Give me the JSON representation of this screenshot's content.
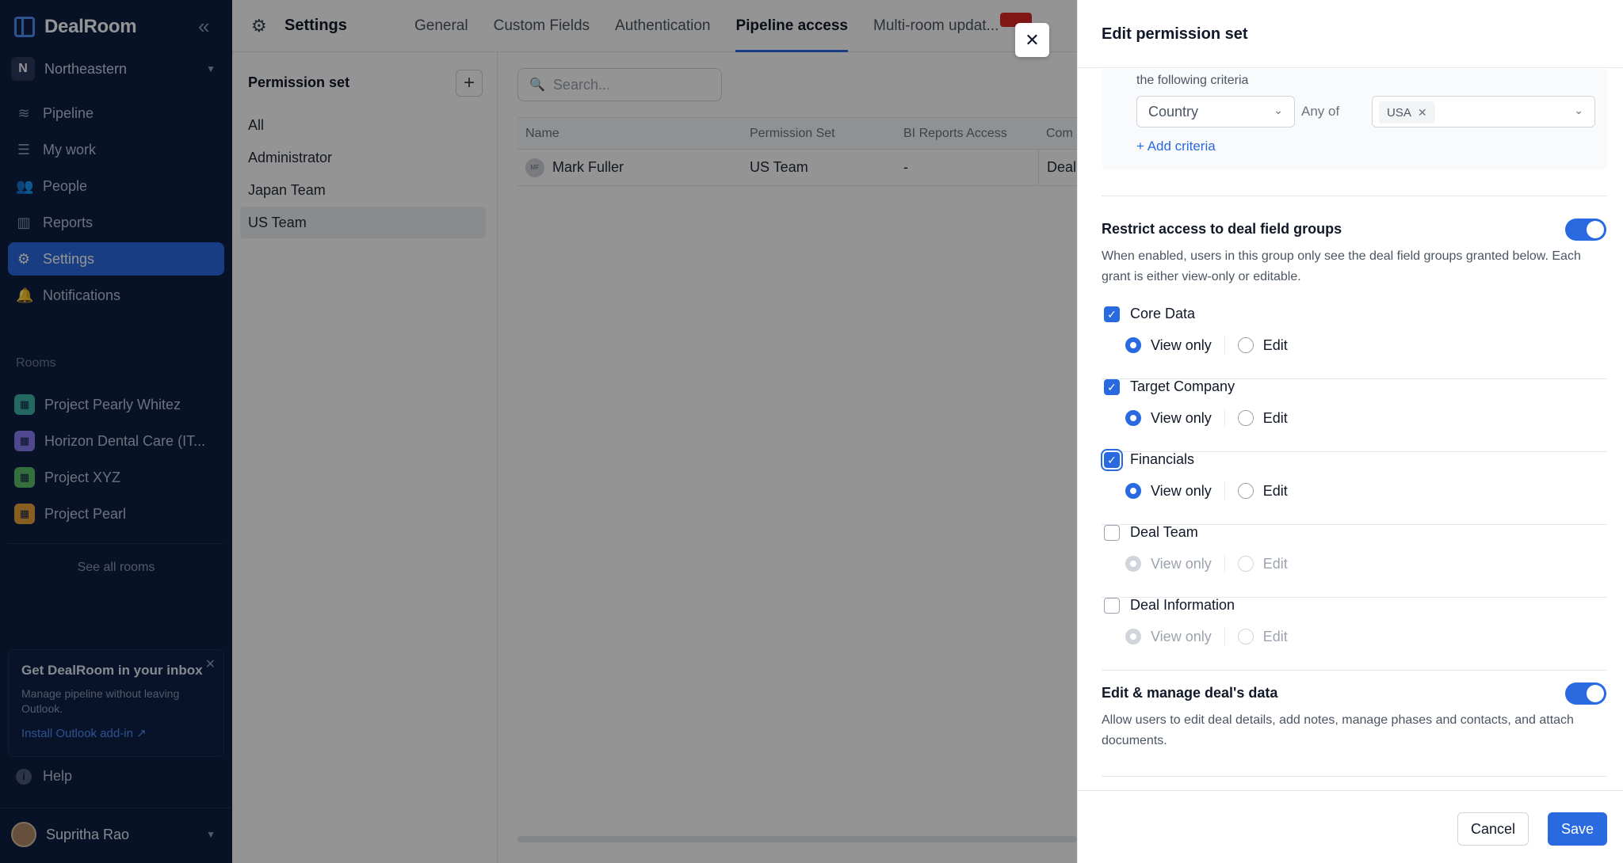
{
  "sidebar": {
    "app_name": "DealRoom",
    "org": {
      "initial": "N",
      "name": "Northeastern"
    },
    "nav": [
      {
        "label": "Pipeline",
        "icon": "layers-icon"
      },
      {
        "label": "My work",
        "icon": "list-icon"
      },
      {
        "label": "People",
        "icon": "people-icon"
      },
      {
        "label": "Reports",
        "icon": "reports-icon"
      },
      {
        "label": "Settings",
        "icon": "gear-icon",
        "active": true
      },
      {
        "label": "Notifications",
        "icon": "bell-icon"
      }
    ],
    "rooms_label": "Rooms",
    "rooms": [
      {
        "label": "Project Pearly Whitez",
        "color": "#3fb6a8"
      },
      {
        "label": "Horizon Dental Care (IT...",
        "color": "#8b7cf6"
      },
      {
        "label": "Project XYZ",
        "color": "#5bbf6a"
      },
      {
        "label": "Project Pearl",
        "color": "#e8a33a"
      }
    ],
    "see_all_rooms": "See all rooms",
    "promo": {
      "title": "Get DealRoom in your inbox",
      "text": "Manage pipeline without leaving Outlook.",
      "link": "Install Outlook add-in"
    },
    "help": "Help",
    "user": {
      "name": "Supritha Rao"
    }
  },
  "header": {
    "title": "Settings",
    "tabs": [
      {
        "label": "General"
      },
      {
        "label": "Custom Fields"
      },
      {
        "label": "Authentication"
      },
      {
        "label": "Pipeline access",
        "active": true
      },
      {
        "label": "Multi-room updat..."
      }
    ]
  },
  "permission_sets": {
    "header": "Permission set",
    "items": [
      {
        "label": "All"
      },
      {
        "label": "Administrator"
      },
      {
        "label": "Japan Team"
      },
      {
        "label": "US Team",
        "active": true
      }
    ]
  },
  "users": {
    "search_placeholder": "Search...",
    "columns": [
      "Name",
      "Permission Set",
      "BI Reports Access",
      "Com"
    ],
    "rows": [
      {
        "initials": "MF",
        "name": "Mark Fuller",
        "set": "US Team",
        "bi": "-",
        "com": "Deal"
      }
    ]
  },
  "drawer": {
    "title": "Edit permission set",
    "criteria": {
      "label": "the following criteria",
      "field": "Country",
      "operator": "Any of",
      "values": [
        "USA"
      ],
      "add_label": "+ Add criteria"
    },
    "restrict": {
      "title": "Restrict access to deal field groups",
      "description": "When enabled, users in this group only see the deal field groups granted below. Each grant is either view-only or editable.",
      "enabled": true,
      "groups": [
        {
          "label": "Core Data",
          "checked": true,
          "access": "view"
        },
        {
          "label": "Target Company",
          "checked": true,
          "access": "view"
        },
        {
          "label": "Financials",
          "checked": true,
          "access": "view",
          "focused": true
        },
        {
          "label": "Deal Team",
          "checked": false,
          "access": "view"
        },
        {
          "label": "Deal Information",
          "checked": false,
          "access": "view"
        }
      ],
      "view_label": "View only",
      "edit_label": "Edit"
    },
    "edit_manage": {
      "title": "Edit & manage deal's data",
      "description": "Allow users to edit deal details, add notes, manage phases and contacts, and attach documents.",
      "enabled": true
    },
    "cancel_label": "Cancel",
    "save_label": "Save"
  },
  "colors": {
    "accent": "#2a6ae0",
    "sidebar_bg": "#0d1f44"
  }
}
